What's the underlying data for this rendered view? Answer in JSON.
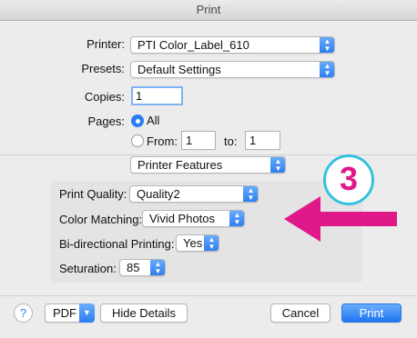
{
  "window": {
    "title": "Print"
  },
  "printer": {
    "label": "Printer:",
    "value": "PTI Color_Label_610"
  },
  "presets": {
    "label": "Presets:",
    "value": "Default Settings"
  },
  "copies": {
    "label": "Copies:",
    "value": "1"
  },
  "pages": {
    "label": "Pages:",
    "all_label": "All",
    "from_label": "From:",
    "from_value": "1",
    "to_label": "to:",
    "to_value": "1",
    "selected": "All"
  },
  "section": {
    "value": "Printer Features"
  },
  "features": {
    "print_quality": {
      "label": "Print Quality:",
      "value": "Quality2"
    },
    "color_matching": {
      "label": "Color Matching:",
      "value": "Vivid Photos"
    },
    "bidirectional": {
      "label": "Bi-directional Printing:",
      "value": "Yes"
    },
    "saturation": {
      "label": "Seturation:",
      "value": "85"
    }
  },
  "annotation": {
    "number": "3",
    "arrow_color": "#e0198a",
    "circle_color": "#35c1e0"
  },
  "footer": {
    "help": "?",
    "pdf": "PDF",
    "hide_details": "Hide Details",
    "cancel": "Cancel",
    "print": "Print"
  },
  "icons": {
    "stepper": "up-down-chevron-icon",
    "dropdown": "chevron-down-icon",
    "help": "question-mark-icon"
  }
}
